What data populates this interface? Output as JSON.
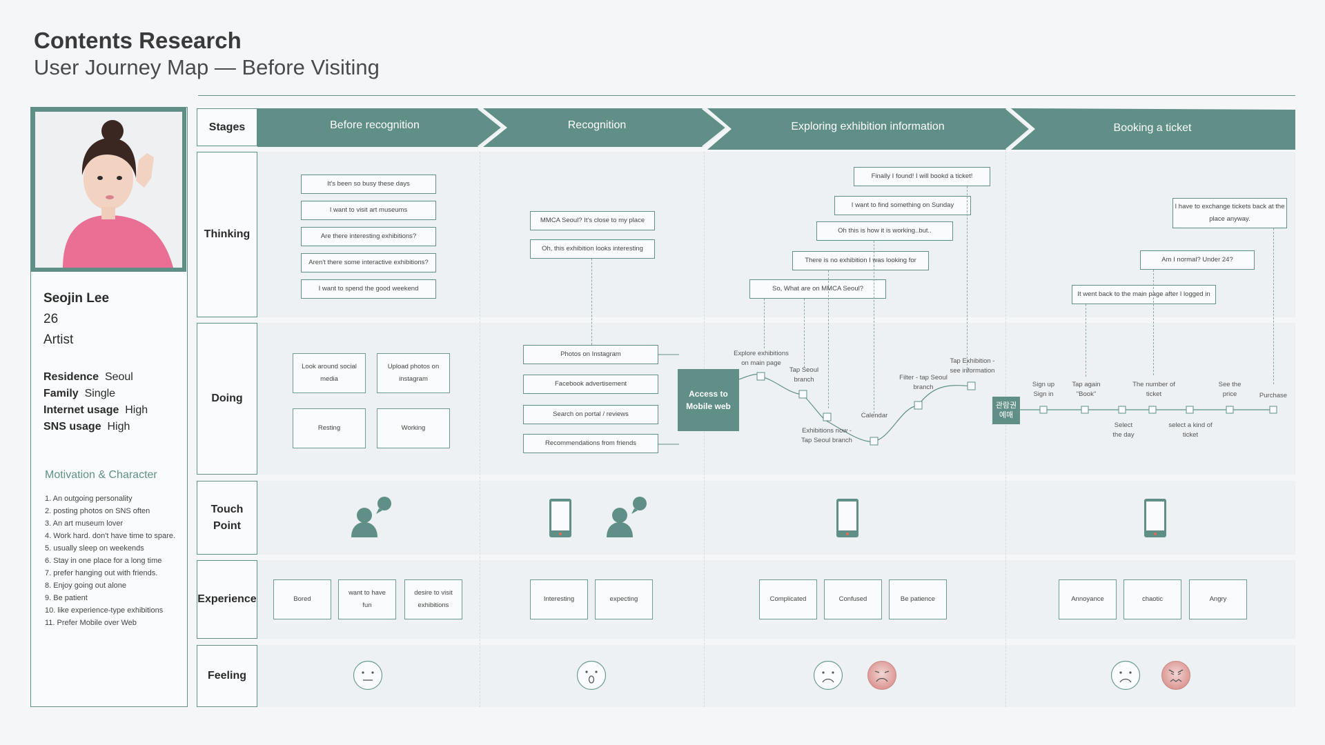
{
  "header": {
    "title": "Contents Research",
    "subtitle": "User Journey Map — Before Visiting"
  },
  "persona": {
    "name": "Seojin Lee",
    "age": "26",
    "job": "Artist",
    "attributes": [
      {
        "label": "Residence",
        "value": "Seoul"
      },
      {
        "label": "Family",
        "value": "Single"
      },
      {
        "label": "Internet usage",
        "value": "High"
      },
      {
        "label": "SNS usage",
        "value": "High"
      }
    ],
    "motivation_title": "Motivation & Character",
    "motivation": [
      "1. An outgoing personality",
      "2. posting photos on SNS often",
      "3. An art museum lover",
      "4. Work hard. don't have time to spare.",
      "5. usually sleep on weekends",
      "6. Stay in one place for a long time",
      "7. prefer hanging out with friends.",
      "8. Enjoy going out alone",
      "9. Be patient",
      "10. like experience-type exhibitions",
      "11. Prefer Mobile over Web"
    ]
  },
  "rows": {
    "stages": "Stages",
    "thinking": "Thinking",
    "doing": "Doing",
    "touch": "Touch\nPoint",
    "experience": "Experience",
    "feeling": "Feeling"
  },
  "stages": [
    "Before recognition",
    "Recognition",
    "Exploring exhibition information",
    "Booking a ticket"
  ],
  "thinking": {
    "s1": [
      "It's been so busy these days",
      "I want to visit art museums",
      "Are there interesting exhibitions?",
      "Aren't there some interactive exhibitions?",
      "I want to spend the good weekend"
    ],
    "s2": [
      "MMCA Seoul? It's close to my place",
      "Oh, this exhibition looks interesting"
    ],
    "s3": [
      "Finally I found! I will bookd a ticket!",
      "I want to find something on Sunday",
      "Oh this is how it is working..but..",
      "There is no exhibition I was looking for",
      "So, What are on MMCA Seoul?"
    ],
    "s4": [
      "I have to exchange tickets back at the place anyway.",
      "Am I normal? Under 24?",
      "It went back to the main page after I logged in"
    ]
  },
  "doing": {
    "s1": [
      "Look around social media",
      "Upload photos on instagram",
      "Resting",
      "Working"
    ],
    "s2": [
      "Photos on Instagram",
      "Facebook advertisement",
      "Search on portal / reviews",
      "Recommendations from friends"
    ],
    "access": "Access to Mobile web",
    "s3_labels": [
      "Explore exhibitions on main page",
      "Tap Seoul branch",
      "Exhibitions now - Tap Seoul branch",
      "Calendar",
      "Filter - tap Seoul branch",
      "Tap Exhibition - see information"
    ],
    "booking": "관람권 예매",
    "s4_labels": [
      "Sign up Sign in",
      "Tap again \"Book\"",
      "Select the day",
      "The number of ticket",
      "select a kind of ticket",
      "See the price",
      "Purchase"
    ]
  },
  "touch": {
    "icons": [
      "person-chat-icon",
      "phone-icon",
      "person-chat-icon",
      "phone-icon",
      "phone-icon"
    ]
  },
  "experience": {
    "s1": [
      "Bored",
      "want to have fun",
      "desire to visit exhibitions"
    ],
    "s2": [
      "Interesting",
      "expecting"
    ],
    "s3": [
      "Complicated",
      "Confused",
      "Be patience"
    ],
    "s4": [
      "Annoyance",
      "chaotic",
      "Angry"
    ]
  },
  "feeling": {
    "faces": [
      "neutral",
      "surprised",
      "sad",
      "upset",
      "sad",
      "angry"
    ]
  },
  "colors": {
    "accent": "#5f8f86",
    "row_bg": "#eef1f3",
    "upset_face": "#e8b4b2"
  }
}
